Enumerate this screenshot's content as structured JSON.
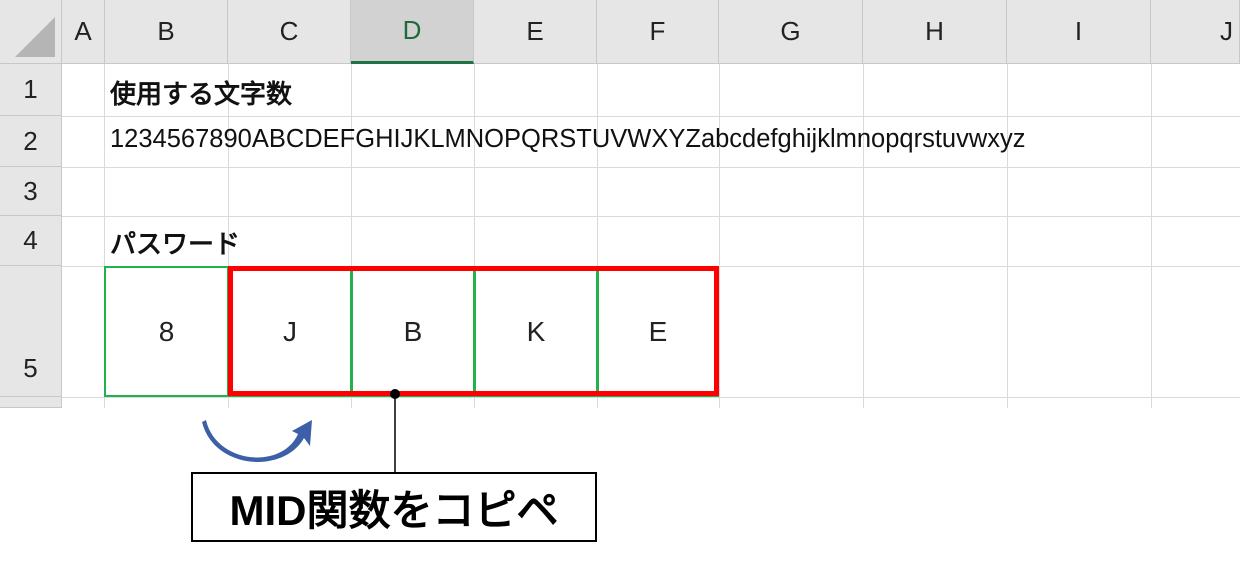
{
  "columns": [
    "A",
    "B",
    "C",
    "D",
    "E",
    "F",
    "G",
    "H",
    "I",
    "J"
  ],
  "selected_column": "D",
  "rows": [
    "1",
    "2",
    "3",
    "4",
    "5"
  ],
  "cells": {
    "B1": "使用する文字数",
    "B2": "1234567890ABCDEFGHIJKLMNOPQRSTUVWXYZabcdefghijklmnopqrstuvwxyz",
    "B4": "パスワード",
    "B5": "8",
    "C5": "J",
    "D5": "B",
    "E5": "K",
    "F5": "E"
  },
  "annotation": {
    "callout": "MID関数をコピペ",
    "highlight_color": "#ff0000",
    "source_border_color": "#22b14c",
    "arrow_color": "#3d5fa8"
  }
}
